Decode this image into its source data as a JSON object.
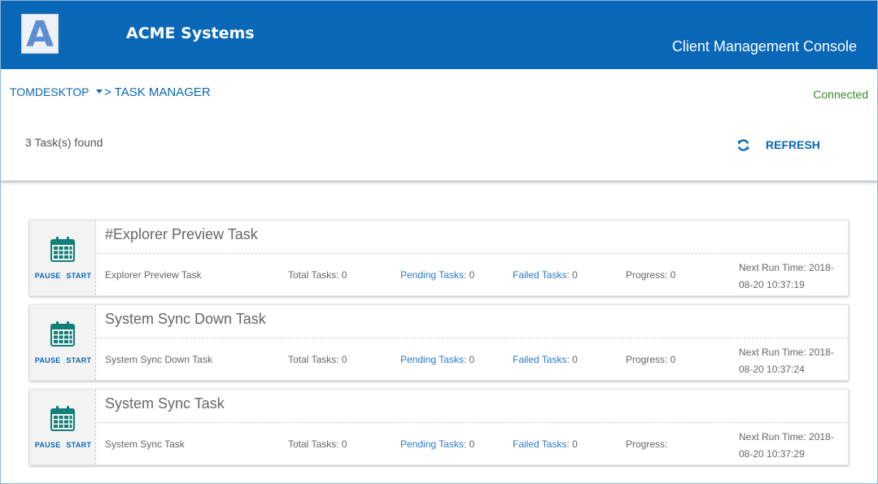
{
  "header": {
    "logo_letter": "A",
    "company": "ACME Systems",
    "console_title": "Client Management Console",
    "brand_color": "#0867b7"
  },
  "subheader": {
    "machine": "TOMDESKTOP",
    "page": "> TASK MANAGER",
    "status": "Connected",
    "count_text": "3 Task(s) found",
    "refresh_label": "REFRESH",
    "refresh_icon": "refresh-icon"
  },
  "tasks": [
    {
      "title": "#Explorer Preview Task",
      "name": "Explorer Preview Task",
      "total": "Total Tasks: 0",
      "pending_label": "Pending Tasks",
      "pending_value": ": 0",
      "failed_label": "Failed Tasks",
      "failed_value": ": 0",
      "progress": "Progress: 0",
      "next_run": "Next Run Time: 2018-08-20 10:37:19",
      "pause": "PAUSE",
      "start": "START",
      "icon": "calendar-icon"
    },
    {
      "title": "System Sync Down Task",
      "name": "System Sync Down Task",
      "total": "Total Tasks: 0",
      "pending_label": "Pending Tasks",
      "pending_value": ": 0",
      "failed_label": "Failed Tasks",
      "failed_value": ": 0",
      "progress": "Progress: 0",
      "next_run": "Next Run Time: 2018-08-20 10:37:24",
      "pause": "PAUSE",
      "start": "START",
      "icon": "calendar-icon"
    },
    {
      "title": "System Sync Task",
      "name": "System Sync Task",
      "total": "Total Tasks: 0",
      "pending_label": "Pending Tasks",
      "pending_value": ": 0",
      "failed_label": "Failed Tasks",
      "failed_value": ": 0",
      "progress": "Progress:",
      "next_run": "Next Run Time: 2018-08-20 10:37:29",
      "pause": "PAUSE",
      "start": "START",
      "icon": "calendar-icon"
    }
  ]
}
